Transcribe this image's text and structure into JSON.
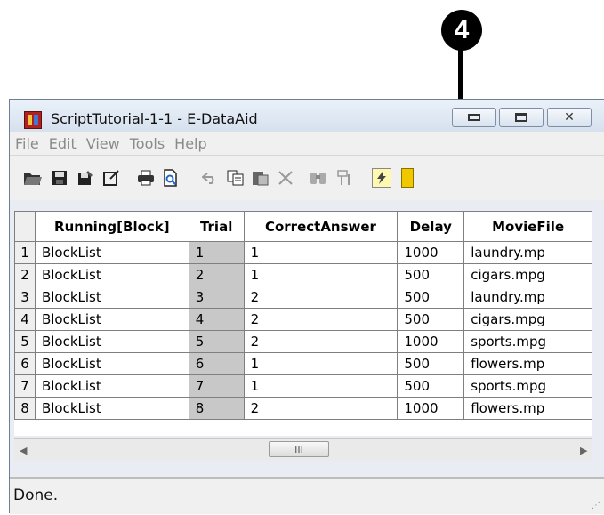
{
  "callout": {
    "number": "4"
  },
  "window": {
    "title": "ScriptTutorial-1-1 - E-DataAid",
    "controls": {
      "minimize": "minimize-icon",
      "maximize": "maximize-icon",
      "close": "✕"
    }
  },
  "menu": [
    "File",
    "Edit",
    "View",
    "Tools",
    "Help"
  ],
  "toolbar": {
    "icons": [
      "open-folder-icon",
      "save-icon",
      "save-as-icon",
      "properties-icon",
      "print-icon",
      "print-preview-icon",
      "undo-icon",
      "copy-icon",
      "paste-icon",
      "delete-icon",
      "find-icon",
      "filter-icon",
      "flash-icon",
      "yellow-icon"
    ]
  },
  "grid": {
    "columns": [
      "Running[Block]",
      "Trial",
      "CorrectAnswer",
      "Delay",
      "MovieFile"
    ],
    "rows": [
      {
        "n": "1",
        "block": "BlockList",
        "trial": "1",
        "answer": "1",
        "delay": "1000",
        "movie": "laundry.mp"
      },
      {
        "n": "2",
        "block": "BlockList",
        "trial": "2",
        "answer": "1",
        "delay": "500",
        "movie": "cigars.mpg"
      },
      {
        "n": "3",
        "block": "BlockList",
        "trial": "3",
        "answer": "2",
        "delay": "500",
        "movie": "laundry.mp"
      },
      {
        "n": "4",
        "block": "BlockList",
        "trial": "4",
        "answer": "2",
        "delay": "500",
        "movie": "cigars.mpg"
      },
      {
        "n": "5",
        "block": "BlockList",
        "trial": "5",
        "answer": "2",
        "delay": "1000",
        "movie": "sports.mpg"
      },
      {
        "n": "6",
        "block": "BlockList",
        "trial": "6",
        "answer": "1",
        "delay": "500",
        "movie": "flowers.mp"
      },
      {
        "n": "7",
        "block": "BlockList",
        "trial": "7",
        "answer": "1",
        "delay": "500",
        "movie": "sports.mpg"
      },
      {
        "n": "8",
        "block": "BlockList",
        "trial": "8",
        "answer": "2",
        "delay": "1000",
        "movie": "flowers.mp"
      }
    ]
  },
  "scrollbar": {
    "thumb_label": "III"
  },
  "status": {
    "text": "Done."
  }
}
